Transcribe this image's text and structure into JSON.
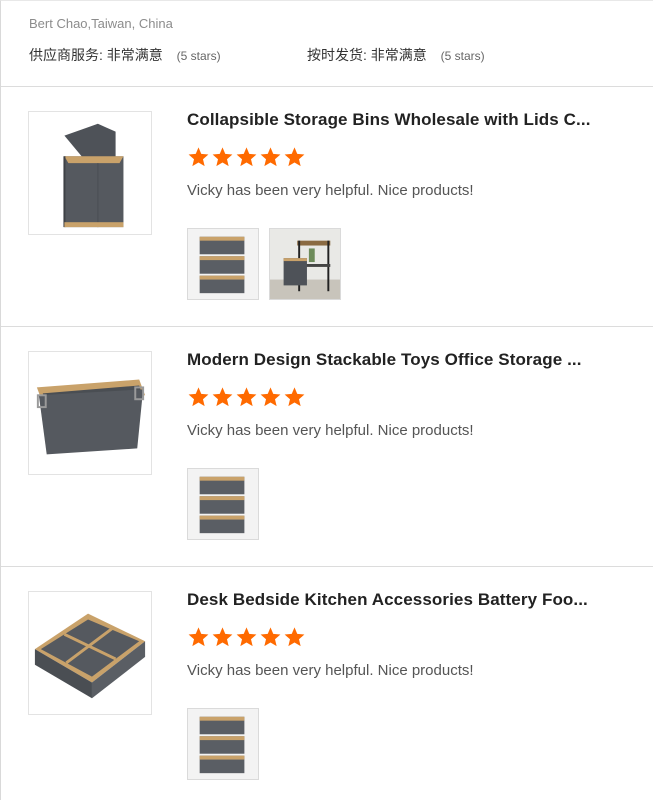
{
  "reviewer": "Bert Chao,Taiwan, China",
  "ratings": [
    {
      "label": "供应商服务:",
      "value": "非常满意",
      "stars": "(5 stars)"
    },
    {
      "label": "按时发货:",
      "value": "非常满意",
      "stars": "(5 stars)"
    }
  ],
  "reviews": [
    {
      "title": "Collapsible Storage Bins Wholesale with Lids C...",
      "rating": 5,
      "comment": "Vicky has been very helpful. Nice products!",
      "image_icon": "lidded-storage-hamper",
      "thumbs": [
        "stacked-bins-photo",
        "shelf-room-photo"
      ]
    },
    {
      "title": "Modern Design Stackable Toys Office Storage ...",
      "rating": 5,
      "comment": "Vicky has been very helpful. Nice products!",
      "image_icon": "rectangular-storage-basket",
      "thumbs": [
        "stacked-bins-photo"
      ]
    },
    {
      "title": "Desk Bedside Kitchen Accessories Battery Foo...",
      "rating": 5,
      "comment": "Vicky has been very helpful. Nice products!",
      "image_icon": "divided-organizer-tray",
      "thumbs": [
        "stacked-bins-photo"
      ]
    }
  ],
  "colors": {
    "star": "#ff6a00",
    "bamboo": "#c9a26a",
    "fabric": "#55595f"
  }
}
